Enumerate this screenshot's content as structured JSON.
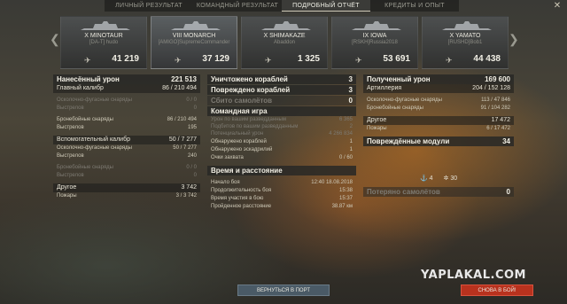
{
  "tabs": [
    {
      "label": "ЛИЧНЫЙ РЕЗУЛЬТАТ"
    },
    {
      "label": "КОМАНДНЫЙ РЕЗУЛЬТАТ"
    },
    {
      "label": "ПОДРОБНЫЙ ОТЧЁТ"
    },
    {
      "label": "КРЕДИТЫ И ОПЫТ"
    }
  ],
  "ships": [
    {
      "name": "X MINOTAUR",
      "player": "[DA-T] hudo",
      "damage": "41 219",
      "icon": "plane-icon"
    },
    {
      "name": "VIII MONARCH",
      "player": "[AMIGO]SupremeCommander",
      "damage": "37 129",
      "icon": "plane-icon"
    },
    {
      "name": "X SHIMAKAZE",
      "player": "Abaddon",
      "damage": "1 325",
      "icon": "plane-icon"
    },
    {
      "name": "IX IOWA",
      "player": "[RSKH]Russia2018",
      "damage": "53 691",
      "icon": "plane-icon"
    },
    {
      "name": "X YAMATO",
      "player": "[RUSHD]Bob1",
      "damage": "44 438",
      "icon": "plane-icon"
    }
  ],
  "damage_dealt": {
    "title": "Нанесённый урон",
    "total": "221 513",
    "main_caliber": {
      "label": "Главный калибр",
      "value": "86 / 210 494"
    },
    "he_label": "Осколочно-фугасные снаряды",
    "he_value": "0 / 0",
    "shots_label": "Выстрелов",
    "shots_value1": "0",
    "ap_label": "Бронебойные снаряды",
    "ap_value": "86 / 210 494",
    "shots_value2": "195",
    "secondary": {
      "label": "Вспомогательный калибр",
      "value": "50 / 7 277"
    },
    "sec_he_value": "50 / 7 277",
    "sec_shots_value": "240",
    "sec_ap_value": "0 / 0",
    "sec_ap_shots": "0",
    "other_label": "Другое",
    "other_value": "3 742",
    "fires_label": "Пожары",
    "fires_value": "3 / 3 742"
  },
  "middle": {
    "destroyed_label": "Уничтожено кораблей",
    "destroyed_value": "3",
    "damaged_label": "Повреждено кораблей",
    "damaged_value": "3",
    "planes_label": "Сбито самолётов",
    "planes_value": "0",
    "team_header": "Командная игра",
    "team_rows": [
      {
        "label": "Урон по вашим разведданным",
        "value": "6 365"
      },
      {
        "label": "Подбитов по вашим разведданным",
        "value": "2"
      },
      {
        "label": "Потенциальный урон",
        "value": "4 266 834"
      },
      {
        "label": "Обнаружено кораблей",
        "value": "1"
      },
      {
        "label": "Обнаружено эскадрилий",
        "value": "1"
      },
      {
        "label": "Очки захвата",
        "value": "0 / 60"
      }
    ],
    "time_header": "Время и расстояние",
    "time_rows": [
      {
        "label": "Начало боя",
        "value": "12:40  18.08.2018"
      },
      {
        "label": "Продолжительность боя",
        "value": "15:38"
      },
      {
        "label": "Время участия в бою",
        "value": "15:37"
      },
      {
        "label": "Пройденное расстояние",
        "value": "38.87 км"
      }
    ]
  },
  "damage_received": {
    "title": "Полученный урон",
    "total": "169 600",
    "artillery_label": "Артиллерия",
    "artillery_value": "204 / 152 128",
    "he_label": "Осколочно-фугасные снаряды",
    "he_value": "113 / 47 846",
    "ap_label": "Бронебойные снаряды",
    "ap_value": "91 / 104 282",
    "other_label": "Другое",
    "other_value": "17 472",
    "fires_label": "Пожары",
    "fires_value": "6 / 17 472",
    "modules_label": "Повреждённые модули",
    "modules_value": "34",
    "icon1_count": "4",
    "icon2_count": "30",
    "planes_lost_label": "Потеряно самолётов",
    "planes_lost_value": "0"
  },
  "buttons": {
    "back": "ВЕРНУТЬСЯ В ПОРТ",
    "again": "СНОВА В БОЙ!"
  },
  "watermark": "YAPLAKAL.COM",
  "colors": {
    "accent_red": "#b8321e",
    "button_blue": "#4a5a66",
    "header_bg": "#2a2a28"
  }
}
